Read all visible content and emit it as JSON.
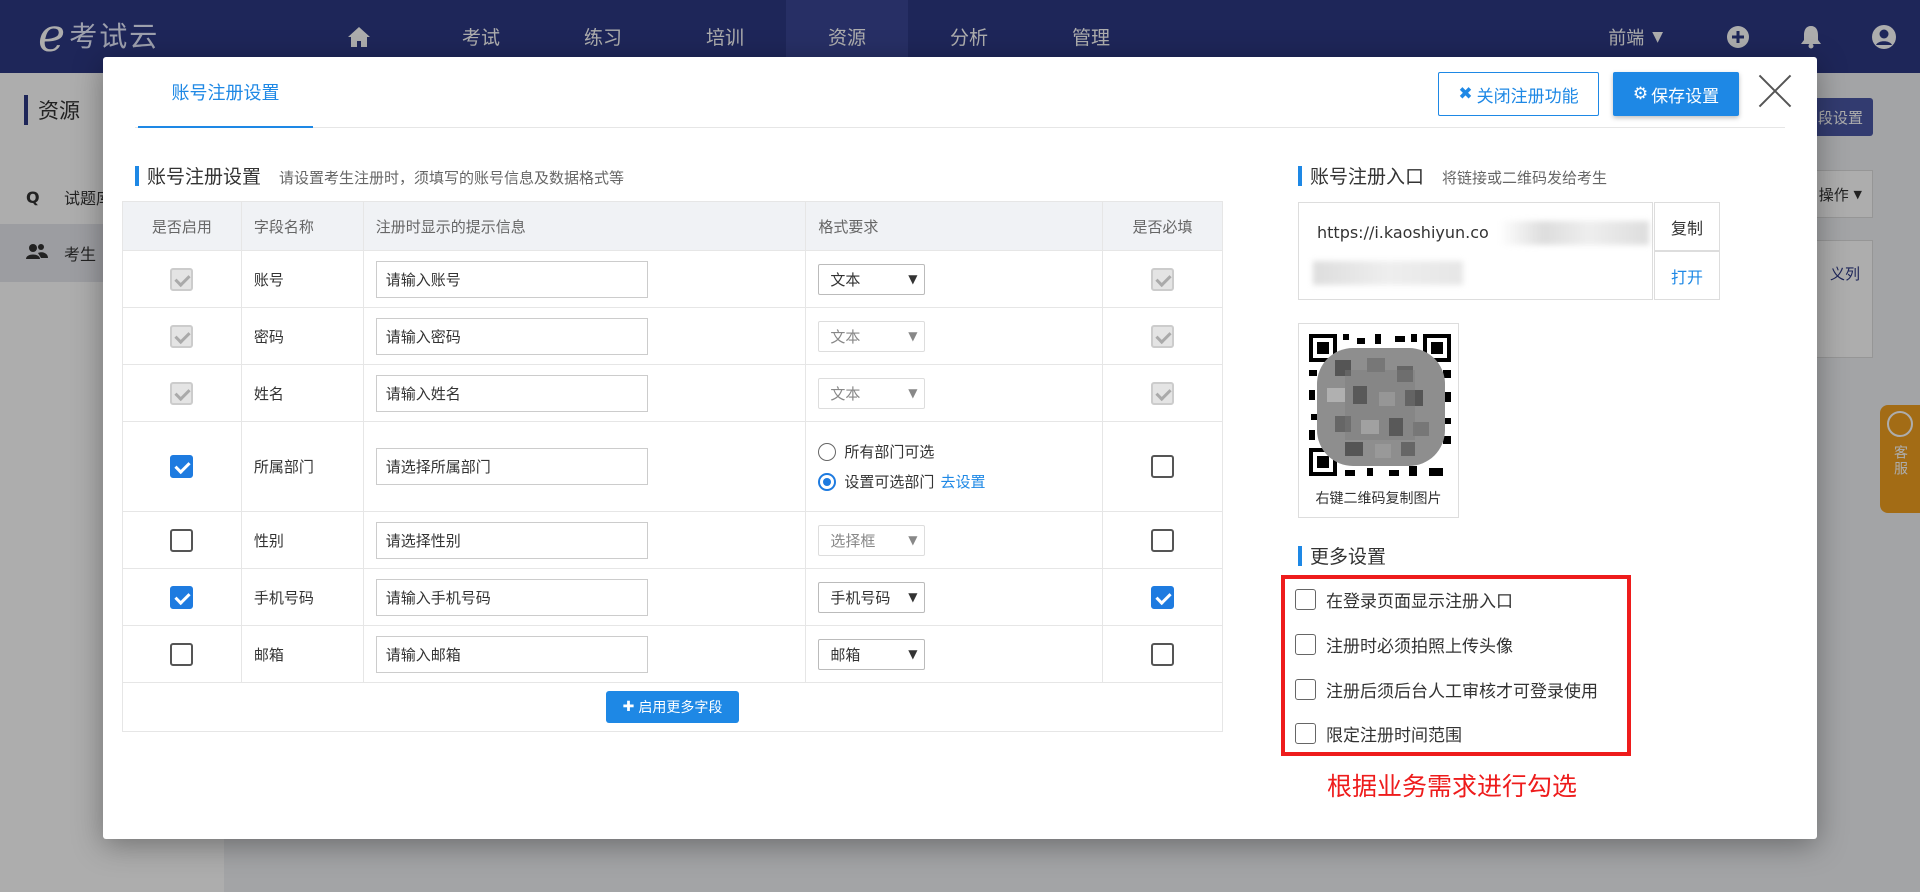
{
  "app": {
    "logo_letter": "e",
    "logo_text": "考试云",
    "nav": [
      "考试",
      "练习",
      "培训",
      "资源",
      "分析",
      "管理"
    ],
    "nav_active": "资源",
    "user": "前端"
  },
  "page": {
    "side_title": "资源",
    "side_items": [
      {
        "icon": "Q",
        "label": "试题库"
      },
      {
        "icon": "users-icon",
        "label": "考生"
      }
    ],
    "right_button": "段设置",
    "right_dropdown": "操作",
    "right_link": "义列",
    "kefu": "客服"
  },
  "modal": {
    "tab": "账号注册设置",
    "close_register_label": "关闭注册功能",
    "save_label": "保存设置",
    "section_title": "账号注册设置",
    "section_desc": "请设置考生注册时，须填写的账号信息及数据格式等",
    "table": {
      "headers": [
        "是否启用",
        "字段名称",
        "注册时显示的提示信息",
        "格式要求",
        "是否必填"
      ],
      "rows": [
        {
          "enabled": "disabled-checked",
          "name": "账号",
          "placeholder": "请输入账号",
          "format": "文本",
          "format_disabled": false,
          "required": "disabled-checked"
        },
        {
          "enabled": "disabled-checked",
          "name": "密码",
          "placeholder": "请输入密码",
          "format": "文本",
          "format_disabled": true,
          "required": "disabled-checked"
        },
        {
          "enabled": "disabled-checked",
          "name": "姓名",
          "placeholder": "请输入姓名",
          "format": "文本",
          "format_disabled": true,
          "required": "disabled-checked"
        },
        {
          "enabled": "checked",
          "name": "所属部门",
          "placeholder": "请选择所属部门",
          "radio_options": [
            "所有部门可选",
            "设置可选部门"
          ],
          "radio_selected": 1,
          "radio_link": "去设置",
          "required": "unchecked"
        },
        {
          "enabled": "unchecked",
          "name": "性别",
          "placeholder": "请选择性别",
          "format": "选择框",
          "format_disabled": true,
          "required": "unchecked"
        },
        {
          "enabled": "checked",
          "name": "手机号码",
          "placeholder": "请输入手机号码",
          "format": "手机号码",
          "format_disabled": false,
          "required": "checked"
        },
        {
          "enabled": "unchecked",
          "name": "邮箱",
          "placeholder": "请输入邮箱",
          "format": "邮箱",
          "format_disabled": false,
          "required": "unchecked"
        }
      ],
      "more_fields_label": "启用更多字段"
    },
    "entry": {
      "title": "账号注册入口",
      "desc": "将链接或二维码发给考生",
      "url": "https://i.kaoshiyun.co",
      "copy_label": "复制",
      "open_label": "打开",
      "qr_caption": "右键二维码复制图片"
    },
    "more_settings": {
      "title": "更多设置",
      "options": [
        {
          "label": "在登录页面显示注册入口",
          "checked": false
        },
        {
          "label": "注册时必须拍照上传头像",
          "checked": false
        },
        {
          "label": "注册后须后台人工审核才可登录使用",
          "checked": false
        },
        {
          "label": "限定注册时间范围",
          "checked": false
        }
      ],
      "annotation": "根据业务需求进行勾选"
    }
  },
  "colors": {
    "nav_bg": "#2d3884",
    "primary": "#1e88e5",
    "annotation_red": "#ee1c1c"
  }
}
